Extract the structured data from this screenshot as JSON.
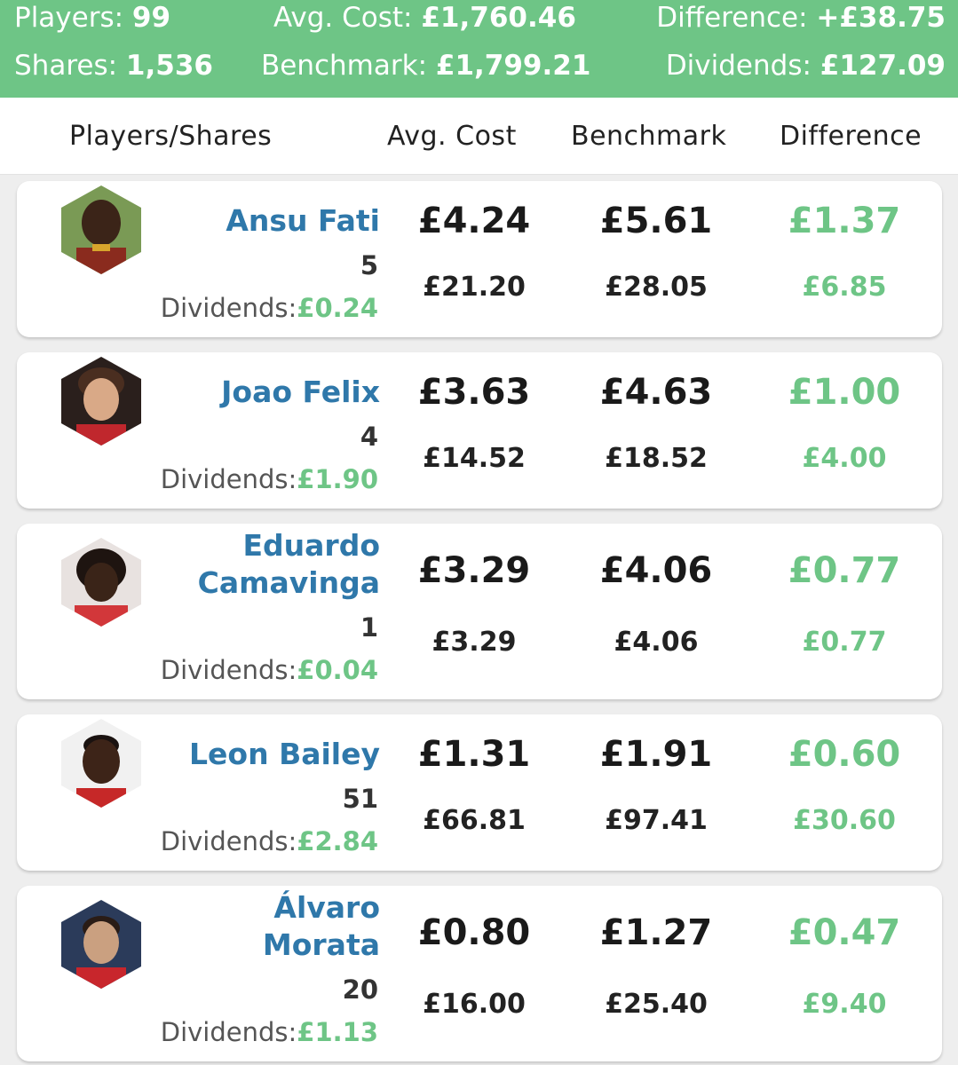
{
  "summary": {
    "players_label": "Players:",
    "players_value": "99",
    "avg_cost_label": "Avg. Cost:",
    "avg_cost_value": "£1,760.46",
    "difference_label": "Difference:",
    "difference_value": "+£38.75",
    "shares_label": "Shares:",
    "shares_value": "1,536",
    "benchmark_label": "Benchmark:",
    "benchmark_value": "£1,799.21",
    "dividends_label": "Dividends:",
    "dividends_value": "£127.09"
  },
  "columns": {
    "players_shares": "Players/Shares",
    "avg_cost": "Avg. Cost",
    "benchmark": "Benchmark",
    "difference": "Difference"
  },
  "dividends_label": "Dividends:",
  "colors": {
    "accent_green": "#6ec586",
    "name_blue": "#2f78aa"
  },
  "players": [
    {
      "name": "Ansu Fati",
      "shares": "5",
      "dividends": "£0.24",
      "avg_cost": "£4.24",
      "avg_cost_total": "£21.20",
      "benchmark": "£5.61",
      "benchmark_total": "£28.05",
      "difference": "£1.37",
      "difference_total": "£6.85",
      "avatar_icon": "player-photo"
    },
    {
      "name": "Joao Felix",
      "shares": "4",
      "dividends": "£1.90",
      "avg_cost": "£3.63",
      "avg_cost_total": "£14.52",
      "benchmark": "£4.63",
      "benchmark_total": "£18.52",
      "difference": "£1.00",
      "difference_total": "£4.00",
      "avatar_icon": "player-photo"
    },
    {
      "name": "Eduardo Camavinga",
      "shares": "1",
      "dividends": "£0.04",
      "avg_cost": "£3.29",
      "avg_cost_total": "£3.29",
      "benchmark": "£4.06",
      "benchmark_total": "£4.06",
      "difference": "£0.77",
      "difference_total": "£0.77",
      "avatar_icon": "player-photo"
    },
    {
      "name": "Leon Bailey",
      "shares": "51",
      "dividends": "£2.84",
      "avg_cost": "£1.31",
      "avg_cost_total": "£66.81",
      "benchmark": "£1.91",
      "benchmark_total": "£97.41",
      "difference": "£0.60",
      "difference_total": "£30.60",
      "avatar_icon": "player-photo"
    },
    {
      "name": "Álvaro Morata",
      "shares": "20",
      "dividends": "£1.13",
      "avg_cost": "£0.80",
      "avg_cost_total": "£16.00",
      "benchmark": "£1.27",
      "benchmark_total": "£25.40",
      "difference": "£0.47",
      "difference_total": "£9.40",
      "avatar_icon": "player-photo"
    }
  ]
}
